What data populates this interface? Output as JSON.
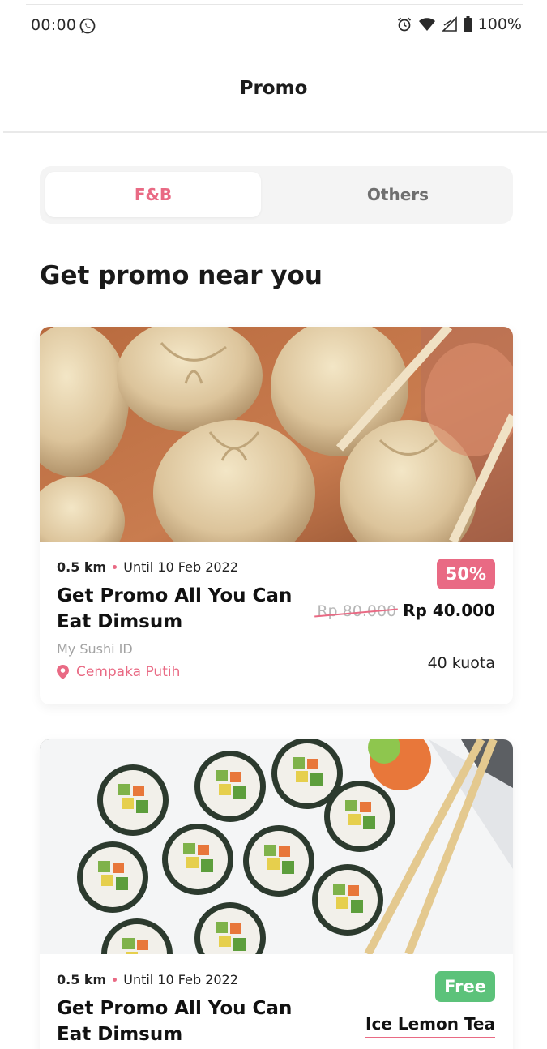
{
  "status_bar": {
    "time": "00:00",
    "battery": "100%",
    "icons": [
      "whatsapp-icon",
      "alarm-icon",
      "wifi-icon",
      "signal-icon",
      "battery-icon"
    ]
  },
  "header": {
    "title": "Promo"
  },
  "tabs": [
    {
      "label": "F&B",
      "active": true
    },
    {
      "label": "Others",
      "active": false
    }
  ],
  "section": {
    "title": "Get promo near you"
  },
  "promos": [
    {
      "distance": "0.5 km",
      "until": "Until 10 Feb 2022",
      "title": "Get Promo All You Can Eat Dimsum",
      "merchant": "My Sushi ID",
      "location": "Cempaka Putih",
      "badge": "50%",
      "old_price": "Rp 80.000",
      "new_price": "Rp 40.000",
      "quota": "40 kuota",
      "image": "dimsum-photo"
    },
    {
      "distance": "0.5 km",
      "until": "Until 10 Feb 2022",
      "title": "Get Promo All You Can Eat Dimsum",
      "badge": "Free",
      "free_item": "Ice Lemon Tea",
      "image": "sushi-photo"
    }
  ],
  "colors": {
    "accent": "#e96a84",
    "free_badge": "#5cc27a",
    "muted": "#a3a3a3",
    "segment_bg": "#f4f4f4"
  }
}
